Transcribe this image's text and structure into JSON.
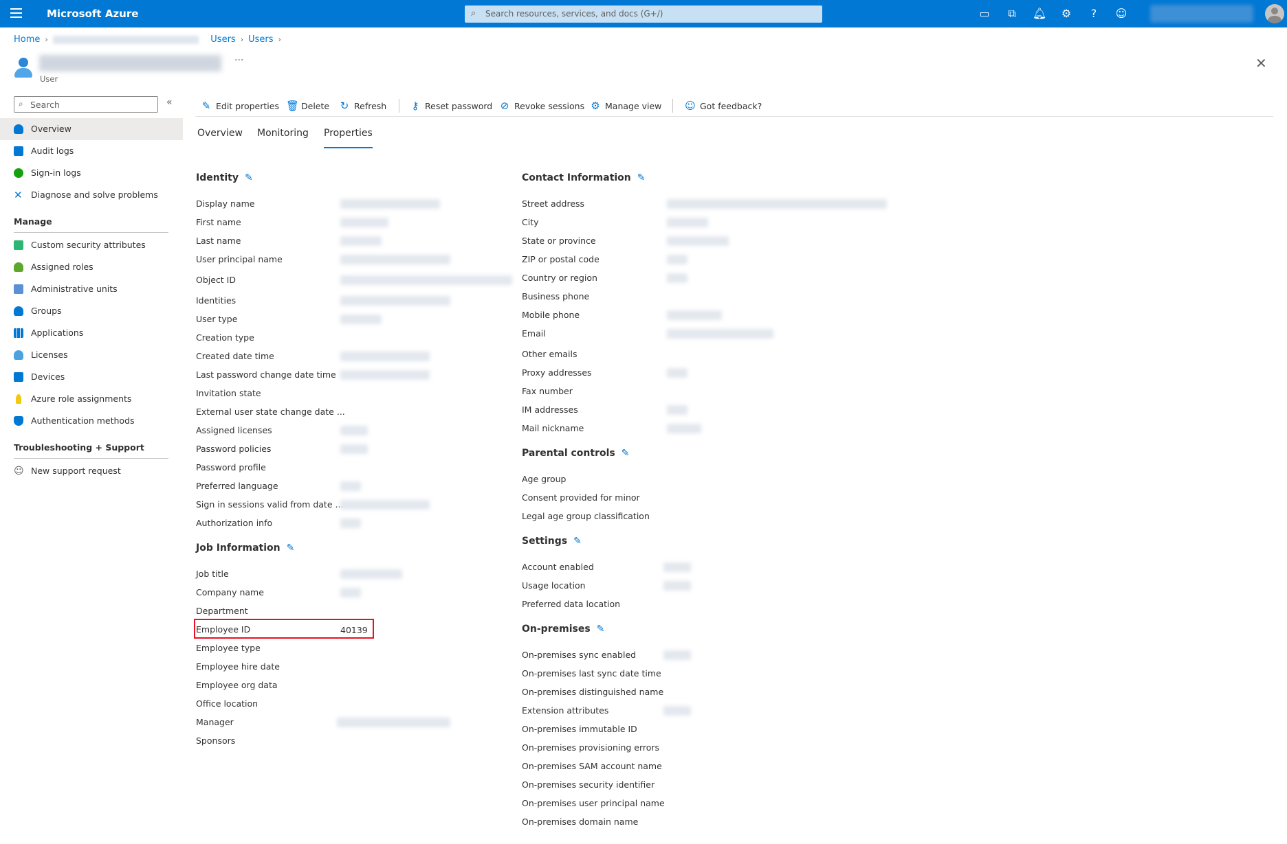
{
  "topbar": {
    "brand": "Microsoft Azure",
    "search_placeholder": "Search resources, services, and docs (G+/)",
    "icons": [
      "cloud-shell-icon",
      "directory-filter-icon",
      "notifications-icon",
      "settings-icon",
      "help-icon",
      "feedback-icon"
    ]
  },
  "breadcrumb": {
    "home": "Home",
    "users1": "Users",
    "users2": "Users"
  },
  "header": {
    "subtitle": "User",
    "more": "···"
  },
  "sidebar": {
    "search_placeholder": "Search",
    "collapse": "«",
    "items": [
      {
        "label": "Overview",
        "icon": "user-icon",
        "color": "#0078d4"
      },
      {
        "label": "Audit logs",
        "icon": "audit-log-icon",
        "color": "#0078d4"
      },
      {
        "label": "Sign-in logs",
        "icon": "sign-in-icon",
        "color": "#13a10e"
      },
      {
        "label": "Diagnose and solve problems",
        "icon": "wrench-icon",
        "color": "#0078d4"
      }
    ],
    "manage_header": "Manage",
    "manage_items": [
      {
        "label": "Custom security attributes",
        "icon": "security-attributes-icon",
        "color": "#2bb673"
      },
      {
        "label": "Assigned roles",
        "icon": "roles-icon",
        "color": "#5ea72f"
      },
      {
        "label": "Administrative units",
        "icon": "admin-units-icon",
        "color": "#5b8fd6"
      },
      {
        "label": "Groups",
        "icon": "groups-icon",
        "color": "#0078d4"
      },
      {
        "label": "Applications",
        "icon": "applications-icon",
        "color": "#0078d4"
      },
      {
        "label": "Licenses",
        "icon": "licenses-icon",
        "color": "#4aa3df"
      },
      {
        "label": "Devices",
        "icon": "devices-icon",
        "color": "#0078d4"
      },
      {
        "label": "Azure role assignments",
        "icon": "key-icon",
        "color": "#f2c811"
      },
      {
        "label": "Authentication methods",
        "icon": "shield-icon",
        "color": "#0078d4"
      }
    ],
    "support_header": "Troubleshooting + Support",
    "support_items": [
      {
        "label": "New support request",
        "icon": "support-icon",
        "color": "#605e5c"
      }
    ]
  },
  "toolbar": {
    "edit": "Edit properties",
    "delete": "Delete",
    "refresh": "Refresh",
    "reset": "Reset password",
    "revoke": "Revoke sessions",
    "manage_view": "Manage view",
    "feedback": "Got feedback?"
  },
  "tabs": {
    "overview": "Overview",
    "monitoring": "Monitoring",
    "properties": "Properties"
  },
  "identity": {
    "title": "Identity",
    "props": [
      "Display name",
      "First name",
      "Last name",
      "User principal name",
      "Object ID",
      "Identities",
      "User type",
      "Creation type",
      "Created date time",
      "Last password change date time",
      "Invitation state",
      "External user state change date ...",
      "Assigned licenses",
      "Password policies",
      "Password profile",
      "Preferred language",
      "Sign in sessions valid from date ...",
      "Authorization info"
    ]
  },
  "job": {
    "title": "Job Information",
    "props": [
      "Job title",
      "Company name",
      "Department",
      "Employee ID",
      "Employee type",
      "Employee hire date",
      "Employee org data",
      "Office location",
      "Manager",
      "Sponsors"
    ],
    "employee_id_value": "40139"
  },
  "contact": {
    "title": "Contact Information",
    "props": [
      "Street address",
      "City",
      "State or province",
      "ZIP or postal code",
      "Country or region",
      "Business phone",
      "Mobile phone",
      "Email",
      "Other emails",
      "Proxy addresses",
      "Fax number",
      "IM addresses",
      "Mail nickname"
    ]
  },
  "parental": {
    "title": "Parental controls",
    "props": [
      "Age group",
      "Consent provided for minor",
      "Legal age group classification"
    ]
  },
  "settings": {
    "title": "Settings",
    "props": [
      "Account enabled",
      "Usage location",
      "Preferred data location"
    ]
  },
  "onprem": {
    "title": "On-premises",
    "props": [
      "On-premises sync enabled",
      "On-premises last sync date time",
      "On-premises distinguished name",
      "Extension attributes",
      "On-premises immutable ID",
      "On-premises provisioning errors",
      "On-premises SAM account name",
      "On-premises security identifier",
      "On-premises user principal name",
      "On-premises domain name"
    ]
  }
}
